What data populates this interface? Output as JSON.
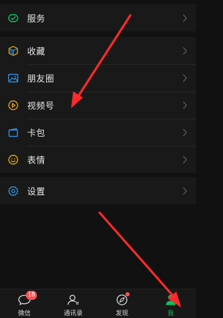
{
  "menu": {
    "services": {
      "label": "服务",
      "icon": "services-icon"
    },
    "favorites": {
      "label": "收藏",
      "icon": "favorites-cube-icon"
    },
    "moments": {
      "label": "朋友圈",
      "icon": "moments-image-icon"
    },
    "channels": {
      "label": "视频号",
      "icon": "channels-play-icon"
    },
    "cards": {
      "label": "卡包",
      "icon": "card-wallet-icon"
    },
    "stickers": {
      "label": "表情",
      "icon": "sticker-smile-icon"
    },
    "settings": {
      "label": "设置",
      "icon": "settings-gear-icon"
    }
  },
  "tabbar": {
    "chats": {
      "label": "微信",
      "badge": "18",
      "icon": "chat-bubble-icon"
    },
    "contacts": {
      "label": "通讯录",
      "icon": "contacts-icon"
    },
    "discover": {
      "label": "发现",
      "icon": "compass-icon",
      "has_dot": true
    },
    "me": {
      "label": "我",
      "icon": "me-person-icon",
      "active": true
    }
  },
  "colors": {
    "accent_green": "#07c160",
    "badge_red": "#fa5151",
    "annotation_arrow": "#ff2a2a",
    "background": "#111111",
    "cell": "#191919"
  }
}
